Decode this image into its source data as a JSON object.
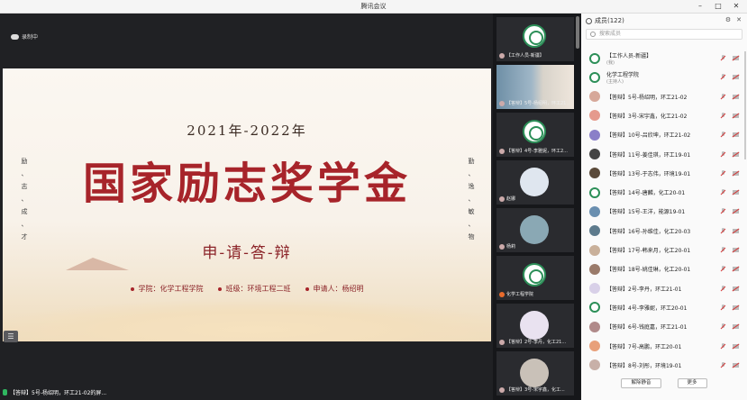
{
  "window": {
    "title": "腾讯会议"
  },
  "stage": {
    "recording_label": "录制中",
    "slide": {
      "year": "2021年-2022年",
      "main_title": "国家励志奖学金",
      "subtitle": "申-请-答-辩",
      "left_vertical": "励、志、成、才",
      "right_vertical": "勤、逸、敏、物",
      "info": [
        "学院：化学工程学院",
        "班级：环境工程二班",
        "申请人：杨绍明"
      ]
    },
    "speaker_label": "【答辩】5号-杨绍明，环工21-02的屏..."
  },
  "thumbnails": [
    {
      "label": "【工作人员-新疆】",
      "type": "logo"
    },
    {
      "label": "【答辩】5号-杨绍明，环工21...",
      "type": "video"
    },
    {
      "label": "【答辩】4号-李雅妮，环工2...",
      "type": "logo"
    },
    {
      "label": "赵娜",
      "type": "face",
      "color": "#dfe6ef"
    },
    {
      "label": "杨莉",
      "type": "face",
      "color": "#8aa8b4"
    },
    {
      "label": "化学工程学院",
      "type": "logo"
    },
    {
      "label": "【答辩】2号-李丹，化工21...",
      "type": "face",
      "color": "#e9e2f0"
    },
    {
      "label": "【答辩】3号-宋宇鑫，化工...",
      "type": "face",
      "color": "#c9c1b8"
    }
  ],
  "panel": {
    "title": "成员(122)",
    "search_placeholder": "搜索成员",
    "members": [
      {
        "name": "【工作人员-新疆】",
        "role": "(我)",
        "avatar": "logo"
      },
      {
        "name": "化学工程学院",
        "role": "(主持人)",
        "avatar": "logo"
      },
      {
        "name": "【答辩】5号-杨绍明，环工21-02",
        "avatar": "#d6a89a"
      },
      {
        "name": "【答辩】3号-宋宇鑫，化工21-02",
        "avatar": "#e59a8d"
      },
      {
        "name": "【答辩】10号-吕欣坤，环工21-02",
        "avatar": "#8a7fc8"
      },
      {
        "name": "【答辩】11号-姜佳琪，环工19-01",
        "avatar": "#444"
      },
      {
        "name": "【答辩】13号-于志伟，环境19-01",
        "avatar": "#5a4a3a"
      },
      {
        "name": "【答辩】14号-唐麟，化工20-01",
        "avatar": "logo"
      },
      {
        "name": "【答辩】15号-王洋，能源19-01",
        "avatar": "#6a8fb0"
      },
      {
        "name": "【答辩】16号-孙维佳，化工20-03",
        "avatar": "#5d7a8c"
      },
      {
        "name": "【答辩】17号-韩来月，化工20-01",
        "avatar": "#c9b09a"
      },
      {
        "name": "【答辩】18号-姚佳琳，化工20-01",
        "avatar": "#9a7a6a"
      },
      {
        "name": "【答辩】2号-李丹，环工21-01",
        "avatar": "#d8d0e8"
      },
      {
        "name": "【答辩】4号-李雅妮，环工20-01",
        "avatar": "logo"
      },
      {
        "name": "【答辩】6号-钱庭嘉，环工21-01",
        "avatar": "#b08a8a"
      },
      {
        "name": "【答辩】7号-高鹏，环工20-01",
        "avatar": "#e8a07a"
      },
      {
        "name": "【答辩】8号-刘彤，环境19-01",
        "avatar": "#c8b0a8"
      }
    ],
    "unmute_all_label": "解除静音",
    "more_label": "更多"
  }
}
